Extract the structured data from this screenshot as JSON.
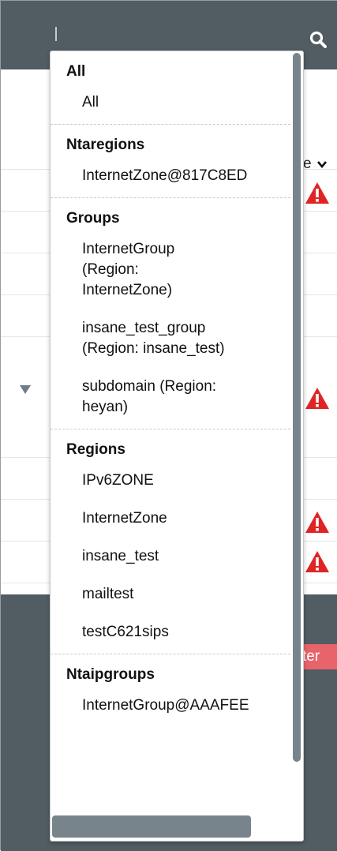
{
  "background": {
    "right_label_fragment": "e",
    "filter_label_fragment": "ter"
  },
  "colors": {
    "topbar": "#515c63",
    "warning": "#e02424",
    "filter_button": "#e8646b",
    "scrollbar": "#78848c"
  },
  "dropdown": {
    "groups": [
      {
        "title": "All",
        "options": [
          "All"
        ]
      },
      {
        "title": "Ntaregions",
        "options": [
          "InternetZone@817C8ED"
        ]
      },
      {
        "title": "Groups",
        "options": [
          "InternetGroup (Region: InternetZone)",
          "insane_test_group (Region: insane_test)",
          "subdomain (Region: heyan)"
        ]
      },
      {
        "title": "Regions",
        "options": [
          "IPv6ZONE",
          "InternetZone",
          "insane_test",
          "mailtest",
          "testC621sips"
        ]
      },
      {
        "title": "Ntaipgroups",
        "options": [
          "InternetGroup@AAAFEE"
        ]
      }
    ]
  },
  "icons": [
    "search-icon",
    "warning-icon",
    "chevron-down-icon",
    "expand-triangle-icon"
  ]
}
